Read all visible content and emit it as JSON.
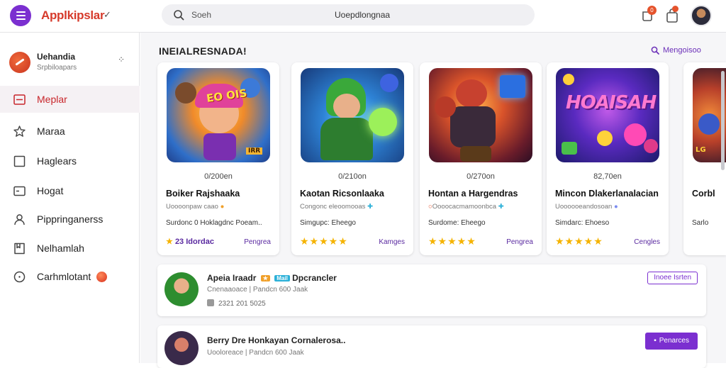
{
  "header": {
    "app_title": "Applkipslar",
    "search_placeholder": "Soeh",
    "search_center_text": "Uoepdlongnaa",
    "notification_count": "0",
    "icons": [
      "menu-icon",
      "search-icon",
      "notification-icon",
      "bag-icon",
      "avatar"
    ]
  },
  "sidebar": {
    "account_name": "Uehandia",
    "account_sub": "Srpbiloapars",
    "items": [
      {
        "label": "Meplar",
        "icon": "store-icon",
        "active": true
      },
      {
        "label": "Maraa",
        "icon": "star-icon",
        "active": false
      },
      {
        "label": "Haglears",
        "icon": "square-icon",
        "active": false
      },
      {
        "label": "Hogat",
        "icon": "card-icon",
        "active": false
      },
      {
        "label": "Pippringanerss",
        "icon": "user-icon",
        "active": false
      },
      {
        "label": "Nelhamlah",
        "icon": "bookmark-icon",
        "active": false
      },
      {
        "label": "Carhmlotant",
        "icon": "info-icon",
        "active": false
      }
    ]
  },
  "section": {
    "title": "INEIALRESNADA!",
    "see_more": "Mengoisoo"
  },
  "cards": [
    {
      "size": "0/200en",
      "title": "Boiker Rajshaaka",
      "sub": "Uoooonpaw caao",
      "dev": "Surdonc 0 Hoklagdnc Poeam..",
      "rating": "23 Idordac",
      "tag": "Pengrea",
      "show_stars": false,
      "accent": "#f0a02a"
    },
    {
      "size": "0/210on",
      "title": "Kaotan Ricsonlaaka",
      "sub": "Congonc eleoomooas",
      "dev": "Simgupc: Eheego",
      "rating": "",
      "tag": "Kamges",
      "show_stars": true,
      "accent": "#4ab83a"
    },
    {
      "size": "0/270on",
      "title": "Hontan a Hargendras",
      "sub": "Oooocacmamoonbca",
      "dev": "Surdome: Eheego",
      "rating": "",
      "tag": "Pengrea",
      "show_stars": true,
      "accent": "#c9331f"
    },
    {
      "size": "82,70en",
      "title": "Mincon Dlakerlanalacian",
      "sub": "Uoooooeandosoan",
      "dev": "Simdarc: Ehoeso",
      "rating": "",
      "tag": "Cengles",
      "show_stars": true,
      "accent": "#7b3fd0"
    },
    {
      "size": "",
      "title": "Corbl",
      "sub": "",
      "dev": "Sarlo",
      "rating": "",
      "tag": "",
      "show_stars": false,
      "accent": "#e6702a"
    }
  ],
  "rows": [
    {
      "title": "Apeia Iraadr",
      "chip": "Mail",
      "title_after": "Dpcrancler",
      "sub": "Cnenaaoace | Pandcn 600 Jaak",
      "meta": "2321 201 5025",
      "button": "Inoee Isrten",
      "button_style": "outline"
    },
    {
      "title": "Berry Dre Honkayan Cornalerosa..",
      "chip": "",
      "title_after": "",
      "sub": "Uooloreace | Pandcn 600 Jaak",
      "meta": "",
      "button": "Penarces",
      "button_style": "fill"
    }
  ],
  "colors": {
    "accent": "#7b2fd0",
    "brand_red": "#d63a2b",
    "active_bg": "#f5f1f4",
    "star": "#f5b301"
  }
}
